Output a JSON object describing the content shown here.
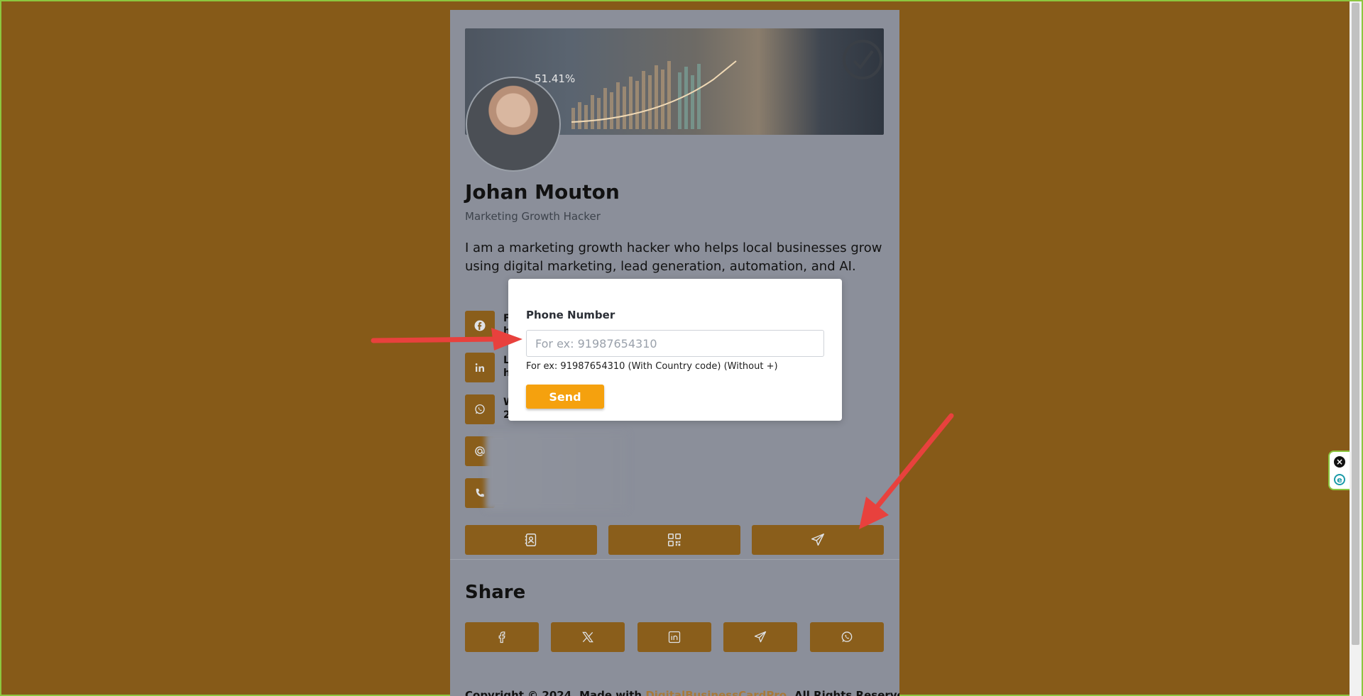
{
  "profile": {
    "name": "Johan Mouton",
    "title": "Marketing Growth Hacker",
    "bio": "I am a marketing growth hacker who helps local businesses grow using digital marketing, lead generation, automation, and AI."
  },
  "banner": {
    "percent_text": "51.41%"
  },
  "contacts": [
    {
      "icon": "facebook-icon",
      "line1": "F",
      "line2": "h"
    },
    {
      "icon": "linkedin-icon",
      "line1": "L",
      "line2": "h"
    },
    {
      "icon": "whatsapp-icon",
      "line1": "W",
      "line2": "2"
    },
    {
      "icon": "at-icon",
      "line1": "",
      "line2": ""
    },
    {
      "icon": "phone-icon",
      "line1": "",
      "line2": ""
    }
  ],
  "actions": [
    "contact-card-icon",
    "qr-code-icon",
    "send-icon"
  ],
  "share": {
    "title": "Share",
    "buttons": [
      "facebook-icon",
      "x-icon",
      "linkedin-icon",
      "telegram-icon",
      "whatsapp-icon"
    ]
  },
  "footer": {
    "prefix": "Copyright © 2024. Made with ",
    "link": "DigitalBusinessCardPro",
    "suffix": ". All Rights Reserved."
  },
  "modal": {
    "label": "Phone Number",
    "placeholder": "For ex: 91987654310",
    "value": "",
    "hint": "For ex: 91987654310 (With Country code) (Without +)",
    "send_label": "Send"
  },
  "colors": {
    "page_bg": "#865a18",
    "accent": "#f5a10e",
    "icon_button": "#8a5e1b",
    "arrow": "#e8413d"
  }
}
